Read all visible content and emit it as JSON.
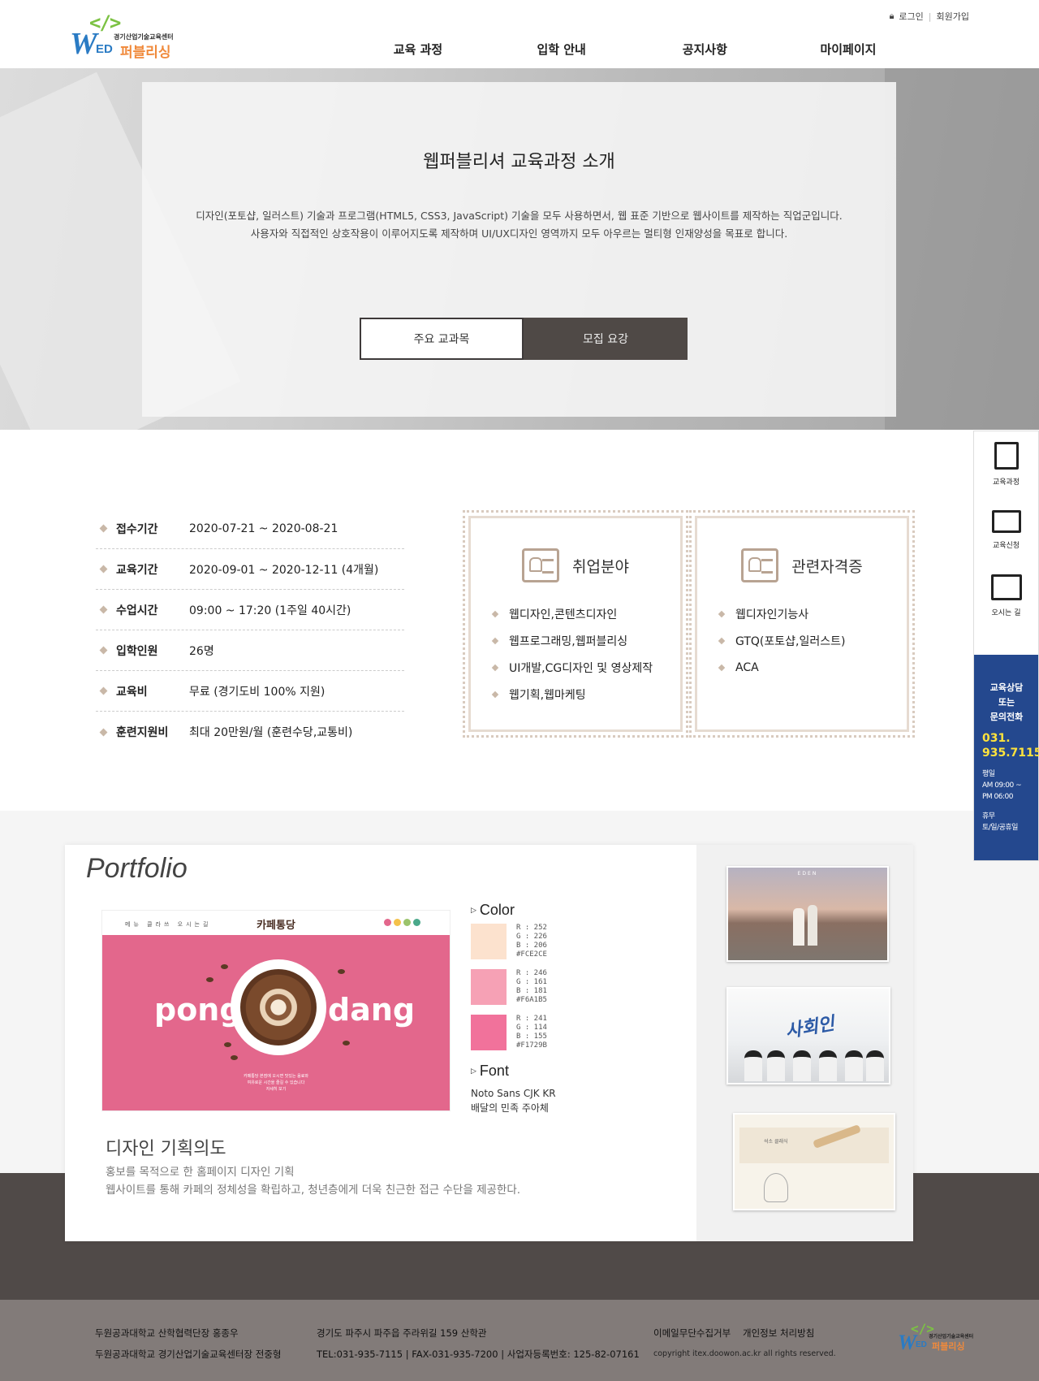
{
  "header": {
    "logo": {
      "brackets": "</>",
      "w": "W",
      "ed": "ED",
      "center": "경기산업기술교육센터",
      "name": "퍼블리싱"
    },
    "util": {
      "login": "로그인",
      "join": "회원가입"
    },
    "nav": [
      "교육 과정",
      "입학 안내",
      "공지사항",
      "마이페이지"
    ]
  },
  "hero": {
    "title": "웹퍼블리셔 교육과정 소개",
    "desc_1": "디자인(포토샵, 일러스트) 기술과 프로그램(HTML5, CSS3, JavaScript) 기술을 모두 사용하면서, 웹 표준 기반으로 웹사이트를 제작하는 직업군입니다.",
    "desc_2": "사용자와 직접적인 상호작용이 이루어지도록 제작하며 UI/UX디자인 영역까지 모두 아우르는 멀티형 인재양성을 목표로 합니다.",
    "btn_subjects": "주요 교과목",
    "btn_recruit": "모집 요강"
  },
  "info": [
    {
      "k": "접수기간",
      "v": "2020-07-21 ~ 2020-08-21"
    },
    {
      "k": "교육기간",
      "v": "2020-09-01 ~ 2020-12-11 (4개월)"
    },
    {
      "k": "수업시간",
      "v": "09:00 ~ 17:20 (1주일 40시간)"
    },
    {
      "k": "입학인원",
      "v": "26명"
    },
    {
      "k": "교육비",
      "v": "무료 (경기도비 100% 지원)"
    },
    {
      "k": "훈련지원비",
      "v": "최대 20만원/월 (훈련수당,교통비)"
    }
  ],
  "job": {
    "title": "취업분야",
    "items": [
      "웹디자인,콘텐츠디자인",
      "웹프로그래밍,웹퍼블리싱",
      "UI개발,CG디자인 및 영상제작",
      "웹기획,웹마케팅"
    ]
  },
  "cert": {
    "title": "관련자격증",
    "items": [
      "웹디자인기능사",
      "GTQ(포토샵,일러스트)",
      "ACA"
    ]
  },
  "quick": {
    "items": [
      {
        "label": "교육과정",
        "icon": "book-icon"
      },
      {
        "label": "교육신청",
        "icon": "monitor-cursor-icon"
      },
      {
        "label": "오시는 길",
        "icon": "map-pin-icon"
      }
    ],
    "contact_1": "교육상담",
    "contact_2": "또는",
    "contact_3": "문의전화",
    "phone_1": "031.",
    "phone_2": "935.7115",
    "hours_1": "평일",
    "hours_2": "AM 09:00 ~",
    "hours_3": "PM 06:00",
    "off_1": "휴무",
    "off_2": "토/일/공휴일"
  },
  "portfolio": {
    "title": "Portfolio",
    "shot": {
      "brand": "카페통당",
      "menu": "메뉴  클라쓰  오시는길",
      "word_1": "pong",
      "word_2": "dang",
      "caption_1": "카페통당 본점에 오시면 맛있는 음료와",
      "caption_2": "여유로운 시간을 즐길 수 있습니다",
      "caption_3": "자세히 보기"
    },
    "color_head": "Color",
    "colors": [
      {
        "hex": "#FCE2CE",
        "r": "R : 252",
        "g": "G : 226",
        "b": "B : 206",
        "code": "#FCE2CE"
      },
      {
        "hex": "#F6A1B5",
        "r": "R : 246",
        "g": "G : 161",
        "b": "B : 181",
        "code": "#F6A1B5"
      },
      {
        "hex": "#F1729B",
        "r": "R : 241",
        "g": "G : 114",
        "b": "B : 155",
        "code": "#F1729B"
      }
    ],
    "font_head": "Font",
    "font_1": "Noto Sans CJK KR",
    "font_2": "배달의 민족 주아체",
    "design_head": "디자인 기획의도",
    "design_1": "홍보를 목적으로  한 홈페이지 디자인 기획",
    "design_2": "웹사이트를 통해 카페의 정체성을 확립하고, 청년층에게 더욱 친근한 접근 수단을 제공한다.",
    "thumb_1": "EDEN",
    "thumb_2": "사회인",
    "thumb_3": "석소 클래식"
  },
  "footer": {
    "l1": "두원공과대학교 산학협력단장 홍종우",
    "l2": "두원공과대학교 경기산업기술교육센터장 전중형",
    "m1": "경기도 파주시 파주읍 주라위길 159 산학관",
    "m2": "TEL:031-935-7115 | FAX-031-935-7200 | 사업자등록번호: 125-82-07161",
    "r1": "이메일무단수집거부",
    "r2": "개인정보 처리방침",
    "copy": "copyright itex.doowon.ac.kr all rights reserved."
  },
  "colors": {
    "accent_navy": "#24488e",
    "phone_yellow": "#ffe33c",
    "logo_green": "#7cc243",
    "logo_blue": "#2a7bc4",
    "logo_orange": "#f08a3c",
    "dark_btn": "#4f4946"
  }
}
